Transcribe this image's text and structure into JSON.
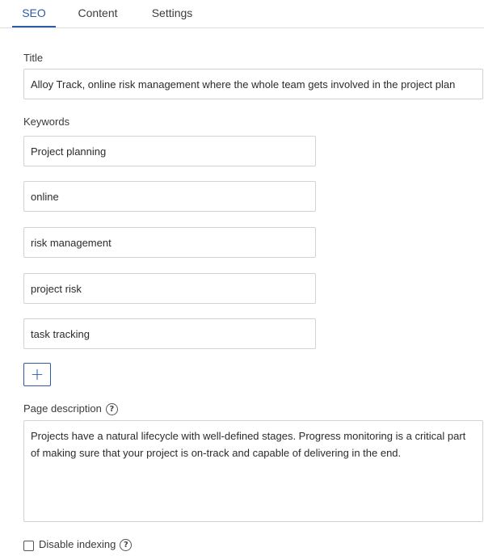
{
  "tabs": [
    {
      "label": "SEO",
      "active": true
    },
    {
      "label": "Content",
      "active": false
    },
    {
      "label": "Settings",
      "active": false
    }
  ],
  "title_label": "Title",
  "title_value": "Alloy Track, online risk management where the whole team gets involved in the project plan",
  "keywords_label": "Keywords",
  "keywords": [
    "Project planning",
    "online",
    "risk management",
    "project risk",
    "task tracking"
  ],
  "add_keyword_symbol": "+",
  "description_label": "Page description",
  "description_value": "Projects have a natural lifecycle with well-defined stages. Progress monitoring is a critical part of making sure that your project is on-track and capable of delivering in the end.",
  "disable_indexing_label": "Disable indexing",
  "disable_indexing_checked": false,
  "help_symbol": "?",
  "accent_color": "#2e5aa6"
}
